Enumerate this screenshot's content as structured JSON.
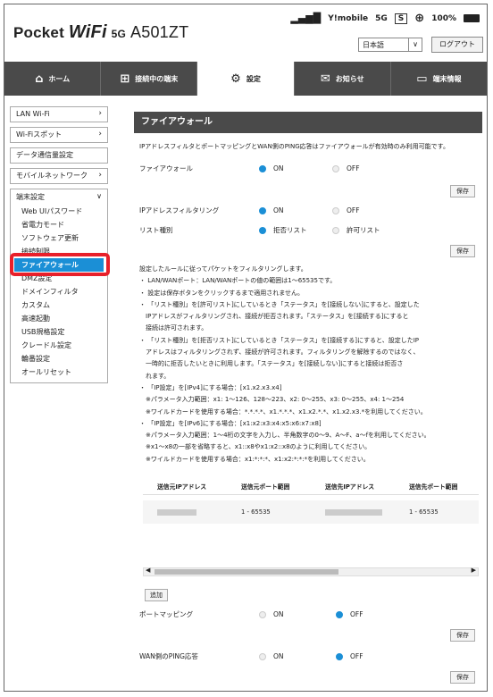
{
  "header": {
    "logo_prefix": "Pocket",
    "logo_brand": "WiFi",
    "logo_5g": "5G",
    "logo_model": "A501ZT",
    "carrier": "Y!mobile",
    "network": "5G",
    "sim": "S",
    "battery": "100%",
    "language": "日本語",
    "logout": "ログアウト"
  },
  "nav": {
    "tabs": [
      {
        "label": "ホーム",
        "icon": "home-icon"
      },
      {
        "label": "接続中の端末",
        "icon": "devices-icon"
      },
      {
        "label": "設定",
        "icon": "gear-icon"
      },
      {
        "label": "お知らせ",
        "icon": "mail-icon"
      },
      {
        "label": "端末情報",
        "icon": "info-icon"
      }
    ],
    "active": "設定"
  },
  "sidebar": {
    "items": [
      "LAN Wi-Fi",
      "Wi-Fiスポット",
      "データ通信量設定",
      "モバイルネットワーク"
    ],
    "group": "端末設定",
    "subitems": [
      "Web UIパスワード",
      "省電力モード",
      "ソフトウェア更新",
      "接続制限",
      "ファイアウォール",
      "DMZ設定",
      "ドメインフィルタ",
      "カスタム",
      "高速起動",
      "USB規格設定",
      "クレードル設定",
      "輪番設定",
      "オールリセット"
    ]
  },
  "main": {
    "title": "ファイアウォール",
    "description": "IPアドレスフィルタとポートマッピングとWAN側のPING応答はファイアウォールが有効時のみ利用可能です。",
    "firewall_label": "ファイアウォール",
    "on": "ON",
    "off": "OFF",
    "save": "保存",
    "ipfilter_label": "IPアドレスフィルタリング",
    "listtype_label": "リスト種別",
    "deny_list": "拒否リスト",
    "allow_list": "許可リスト",
    "rules": [
      "設定したルールに従ってパケットをフィルタリングします。",
      "・ LAN/WANポート：LAN/WANポートの値の範囲は1～65535です。",
      "・ 設定は保存ボタンをクリックするまで適用されません。",
      "・ 「リスト種別」を[許可リスト]にしているとき「ステータス」を[接続しない]にすると、設定した",
      "　IPアドレスがフィルタリングされ、接続が拒否されます。「ステータス」を[接続する]にすると",
      "　接続は許可されます。",
      "・ 「リスト種別」を[拒否リスト]にしているとき「ステータス」を[接続する]にすると、設定したIP",
      "　アドレスはフィルタリングされず、接続が許可されます。フィルタリングを解除するのではなく、",
      "　一時的に拒否したいときに利用します。「ステータス」を[接続しない]にすると接続は拒否さ",
      "　れます。",
      "・ 「IP設定」を[IPv4]にする場合：[x1.x2.x3.x4]",
      "　※パラメータ入力範囲：x1: 1～126、128～223、x2: 0～255、x3: 0～255、x4: 1～254",
      "　※ワイルドカードを使用する場合：*.*.*.*、x1.*.*.*、x1.x2.*.*、x1.x2.x3.*を利用してください。",
      "・ 「IP設定」を[IPv6]にする場合：[x1:x2:x3:x4:x5:x6:x7:x8]",
      "　※パラメータ入力範囲：1～4桁の文字を入力し、半角数字の0～9、A～F、a～fを利用してください。",
      "　※x1～x8の一部を省略すると、x1::x8やx1:x2::x8のように利用してください。",
      "　※ワイルドカードを使用する場合：x1:*:*:*、x1:x2:*:*:*を利用してください。"
    ],
    "table": {
      "headers": [
        "送信元IPアドレス",
        "送信元ポート範囲",
        "送信先IPアドレス",
        "送信先ポート範囲"
      ],
      "row": [
        "",
        "1 - 65535",
        "",
        "1 - 65535"
      ]
    },
    "add": "追加",
    "portmap_label": "ポートマッピング",
    "ping_label": "WAN側のPING応答"
  }
}
